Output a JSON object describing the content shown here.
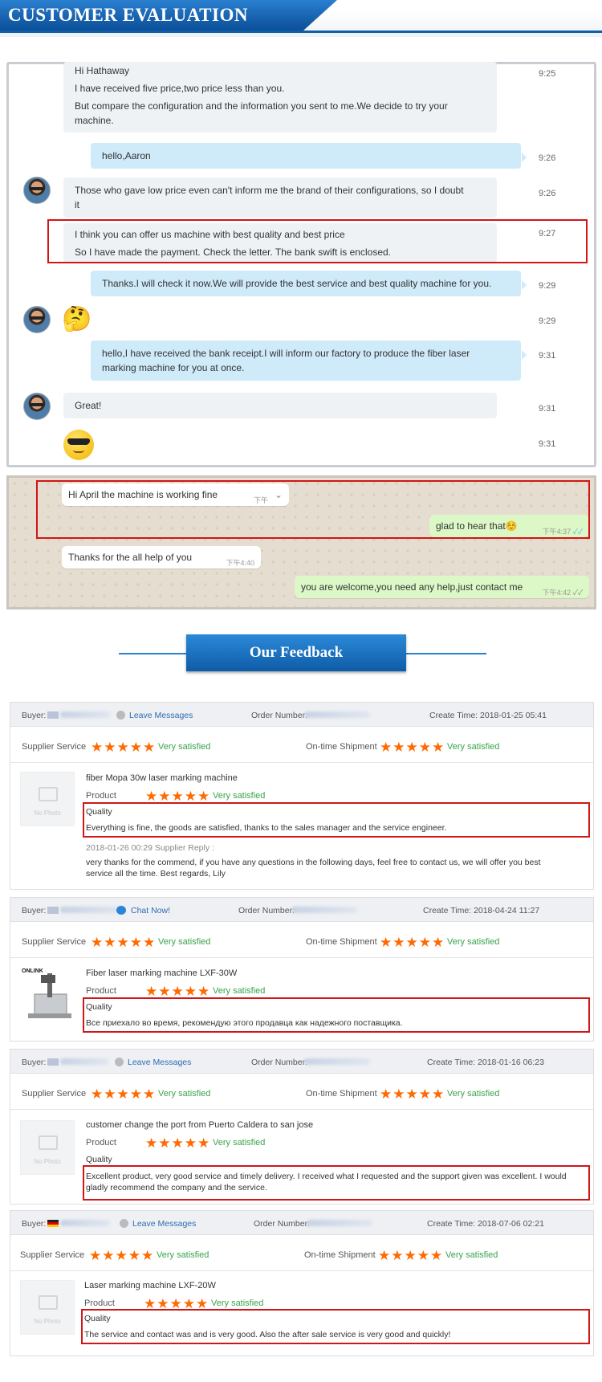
{
  "header": {
    "title": "CUSTOMER EVALUATION"
  },
  "chat": {
    "messages": [
      {
        "lines": [
          "Hi Hathaway",
          "I have received five price,two price less than you.",
          "But compare the configuration and the information you sent to me.We decide to try your",
          "machine."
        ],
        "time": "9:25"
      },
      {
        "lines": [
          "hello,Aaron"
        ],
        "time": "9:26"
      },
      {
        "lines": [
          "Those who gave low price even can't inform me the brand of their configurations, so I doubt",
          "it"
        ],
        "time": "9:26"
      },
      {
        "lines": [
          "I think you can offer us machine with best quality and best price",
          "So I have made the payment. Check the letter. The bank swift is enclosed."
        ],
        "time": "9:27"
      },
      {
        "lines": [
          "Thanks.I will check it now.We will provide the best service and best quality machine for you."
        ],
        "time": "9:29"
      },
      {
        "lines": [
          "🤔"
        ],
        "time": "9:29"
      },
      {
        "lines": [
          "hello,I have received the bank receipt.I will inform our factory to produce the fiber laser",
          "marking machine for you at once."
        ],
        "time": "9:31"
      },
      {
        "lines": [
          "Great!"
        ],
        "time": "9:31"
      },
      {
        "lines": [
          ""
        ],
        "time": "9:31"
      }
    ]
  },
  "whatsapp": {
    "m1": {
      "text": "Hi April the machine is working fine",
      "time": "下午"
    },
    "m2": {
      "text": "glad to hear that☺️",
      "time": "下午4:37",
      "ticks": "✓✓"
    },
    "m3": {
      "text": "Thanks for the all help of you",
      "time": "下午4:40"
    },
    "m4": {
      "text": "you are welcome,you need any help,just contact me",
      "time": "下午4:42",
      "ticks": "✓✓"
    }
  },
  "feedback_title": "Our Feedback",
  "labels": {
    "buyer": "Buyer:",
    "order": "Order Number:",
    "create": "Create Time:",
    "supplier": "Supplier Service",
    "shipment": "On-time Shipment",
    "product": "Product",
    "quality": "Quality",
    "sat": "Very satisfied",
    "stars": "★★★★★",
    "no_photo": "No Photo"
  },
  "reviews": [
    {
      "action": "Leave Messages",
      "create_time": "2018-01-25 05:41",
      "product": "fiber Mopa 30w laser marking machine",
      "quality_text": "Everything is fine, the goods are satisfied, thanks to the sales manager and the service engineer.",
      "reply_head": "2018-01-26 00:29  Supplier Reply :",
      "reply_1": "very thanks for the commend, if you have any questions in the following days, feel free to contact us, we will offer you best",
      "reply_2": "service all the time. Best regards, Lily"
    },
    {
      "action": "Chat Now!",
      "create_time": "2018-04-24 11:27",
      "product": "Fiber laser marking machine LXF-30W",
      "quality_text": "Все приехало во время, рекомендую этого продавца как надежного поставщика.",
      "brand": "ONLINK"
    },
    {
      "action": "Leave Messages",
      "create_time": "2018-01-16 06:23",
      "product": "customer change the port from Puerto Caldera to san jose",
      "quality_1": "Excellent product, very good service and timely delivery. I received what I requested and the support given was excellent. I would",
      "quality_2": "gladly recommend the company and the service."
    },
    {
      "action": "Leave Messages",
      "create_time": "2018-07-06 02:21",
      "product": "Laser marking machine LXF-20W",
      "quality_text": "The service and contact was and is very good. Also the after sale service is very good and quickly!"
    }
  ]
}
